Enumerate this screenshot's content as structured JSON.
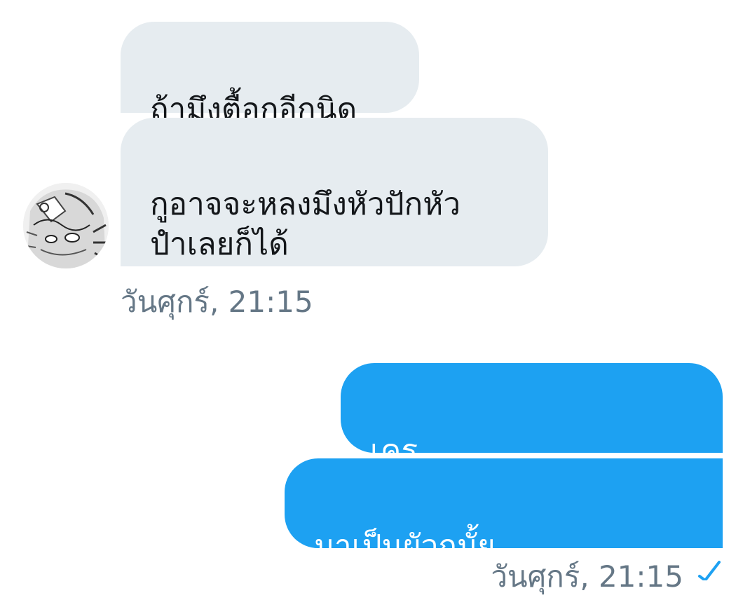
{
  "conversation": {
    "incoming": [
      {
        "text": "ถ้ามึงตื้อกูอีกนิด"
      },
      {
        "text": "กูอาจจะหลงมึงหัวปักหัว\nปำเลยก็ได้"
      }
    ],
    "incoming_timestamp": "วันศุกร์, 21:15",
    "outgoing": [
      {
        "text": "เคร"
      },
      {
        "text": "มาเป็นผัวกุมั้ย"
      }
    ],
    "outgoing_timestamp": "วันศุกร์, 21:15",
    "status_icon": "check-icon"
  },
  "colors": {
    "incoming_bubble": "#e6ecf0",
    "outgoing_bubble": "#1da1f2",
    "timestamp": "#657786"
  }
}
